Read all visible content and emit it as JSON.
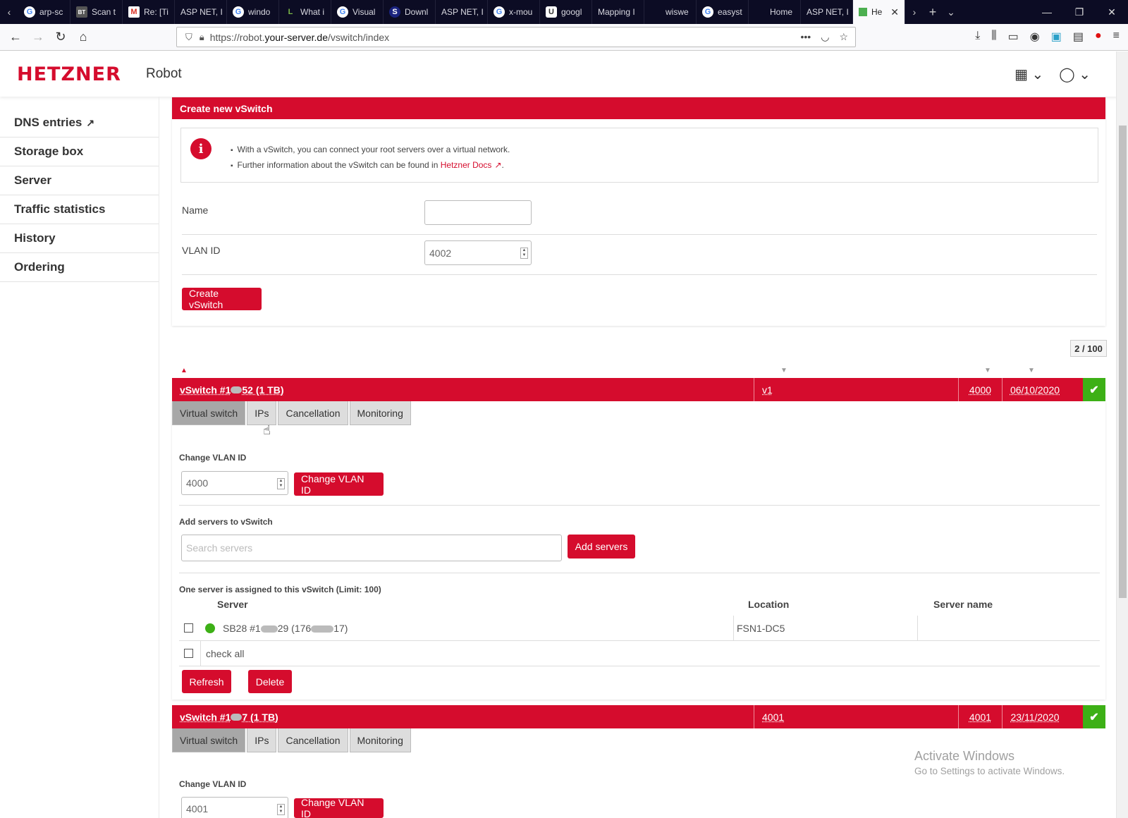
{
  "browser": {
    "tabs": [
      {
        "label": "arp-sc",
        "icon": "G"
      },
      {
        "label": "Scan t",
        "icon": "BT"
      },
      {
        "label": "Re: [Ti",
        "icon": "M"
      },
      {
        "label": "ASP NET, I",
        "icon": ""
      },
      {
        "label": "windo",
        "icon": "G"
      },
      {
        "label": "What i",
        "icon": "L"
      },
      {
        "label": "Visual",
        "icon": "G"
      },
      {
        "label": "Downl",
        "icon": "S"
      },
      {
        "label": "ASP NET, I",
        "icon": ""
      },
      {
        "label": "x-mou",
        "icon": "G"
      },
      {
        "label": "googl",
        "icon": "U"
      },
      {
        "label": "Mapping I",
        "icon": ""
      },
      {
        "label": "wiswe",
        "icon": ""
      },
      {
        "label": "easyst",
        "icon": "G"
      },
      {
        "label": "Home",
        "icon": ""
      },
      {
        "label": "ASP NET, I",
        "icon": ""
      }
    ],
    "active_tab": {
      "label": "He"
    },
    "url_prefix": "https://robot.",
    "url_host": "your-server.de",
    "url_path": "/vswitch/index"
  },
  "app": {
    "logo": "HETZNER",
    "product": "Robot"
  },
  "sidebar": {
    "items": [
      {
        "label": "DNS entries"
      },
      {
        "label": "Storage box"
      },
      {
        "label": "Server"
      },
      {
        "label": "Traffic statistics"
      },
      {
        "label": "History"
      },
      {
        "label": "Ordering"
      }
    ]
  },
  "create": {
    "title": "Create new vSwitch",
    "info_line1": "With a vSwitch, you can connect your root servers over a virtual network.",
    "info_line2_prefix": "Further information about the vSwitch can be found in",
    "info_link": "Hetzner Docs",
    "name_label": "Name",
    "name_value": "",
    "vlan_label": "VLAN ID",
    "vlan_value": "4002",
    "button": "Create vSwitch"
  },
  "counter": "2 / 100",
  "vswitches": [
    {
      "name_prefix": "vSwitch #1",
      "name_suffix": "52 (1 TB)",
      "name_field": "v1",
      "vlan": "4000",
      "date": "06/10/2020",
      "tabs": [
        "Virtual switch",
        "IPs",
        "Cancellation",
        "Monitoring"
      ],
      "change_vlan_label": "Change VLAN ID",
      "change_vlan_value": "4000",
      "change_vlan_button": "Change VLAN ID",
      "add_servers_label": "Add servers to vSwitch",
      "search_placeholder": "Search servers",
      "add_servers_button": "Add servers",
      "assigned_text": "One server is assigned to this vSwitch (Limit: 100)",
      "columns": [
        "Server",
        "Location",
        "Server name"
      ],
      "servers": [
        {
          "server_a": "SB28 #1",
          "server_b": "29 (176",
          "server_c": "17)",
          "location": "FSN1-DC5",
          "server_name": ""
        }
      ],
      "check_all": "check all",
      "refresh_button": "Refresh",
      "delete_button": "Delete"
    },
    {
      "name_prefix": "vSwitch #1",
      "name_suffix": "7 (1 TB)",
      "name_field": "4001",
      "vlan": "4001",
      "date": "23/11/2020",
      "tabs": [
        "Virtual switch",
        "IPs",
        "Cancellation",
        "Monitoring"
      ],
      "change_vlan_label": "Change VLAN ID",
      "change_vlan_value": "4001",
      "change_vlan_button": "Change VLAN ID"
    }
  ],
  "watermark": {
    "line1": "Activate Windows",
    "line2": "Go to Settings to activate Windows."
  },
  "colors": {
    "brand_red": "#d50c2d",
    "status_green": "#3db016"
  }
}
